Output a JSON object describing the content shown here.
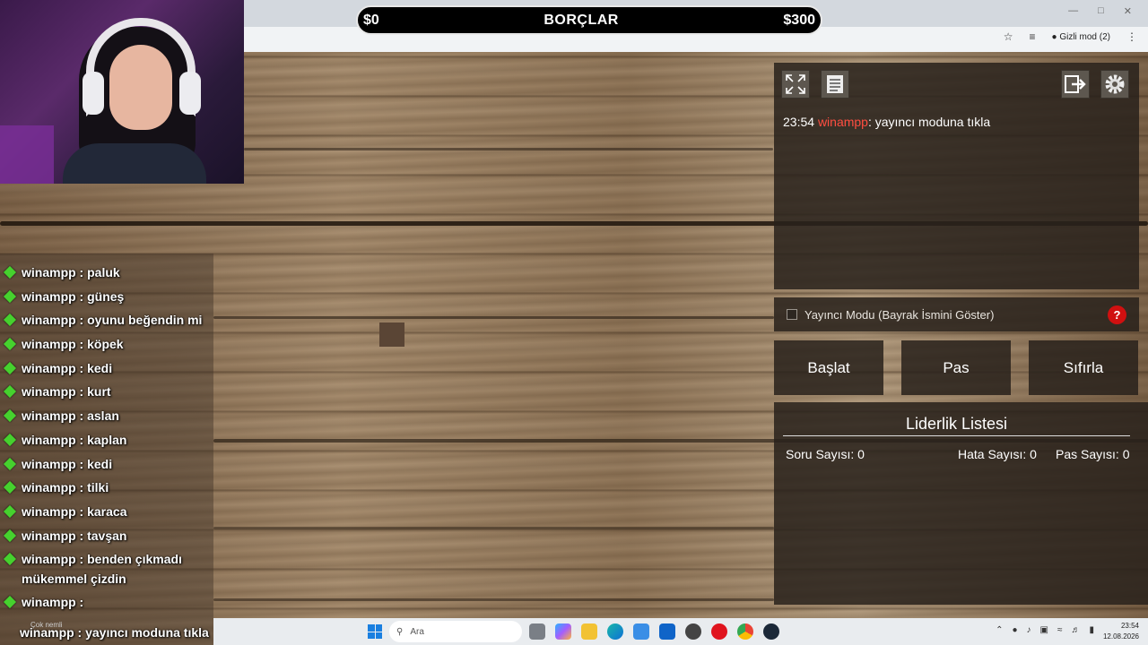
{
  "debt_bar": {
    "left_value": "$0",
    "title": "BORÇLAR",
    "right_value": "$300"
  },
  "browser": {
    "incognito_label": "Gizli mod (2)"
  },
  "overlay_chat": {
    "cut_line": "",
    "items": [
      {
        "text": "winampp : paluk"
      },
      {
        "text": "winampp : güneş"
      },
      {
        "text": "winampp : oyunu beğendin mi"
      },
      {
        "text": "winampp : köpek"
      },
      {
        "text": "winampp : kedi"
      },
      {
        "text": "winampp : kurt"
      },
      {
        "text": "winampp : aslan"
      },
      {
        "text": "winampp : kaplan"
      },
      {
        "text": "winampp : kedi"
      },
      {
        "text": "winampp : tilki"
      },
      {
        "text": "winampp : karaca"
      },
      {
        "text": "winampp : tavşan"
      },
      {
        "text": "winampp : benden çıkmadı mükemmel çizdin"
      },
      {
        "text": "winampp :"
      }
    ],
    "last_line": "winampp : yayıncı moduna tıkla"
  },
  "game_chat": {
    "time": "23:54",
    "user": "winampp",
    "message": ": yayıncı moduna tıkla"
  },
  "streamer_mode": {
    "label": "Yayıncı Modu (Bayrak İsmini Göster)",
    "help": "?"
  },
  "buttons": {
    "start": "Başlat",
    "pass": "Pas",
    "reset": "Sıfırla"
  },
  "leaderboard": {
    "title": "Liderlik Listesi",
    "question_count": "Soru Sayısı: 0",
    "error_count": "Hata Sayısı: 0",
    "pass_count": "Pas Sayısı: 0"
  },
  "taskbar": {
    "search_placeholder": "Ara",
    "weather": "Çok nemli",
    "time": "23:54",
    "date": "12.08.2026"
  }
}
